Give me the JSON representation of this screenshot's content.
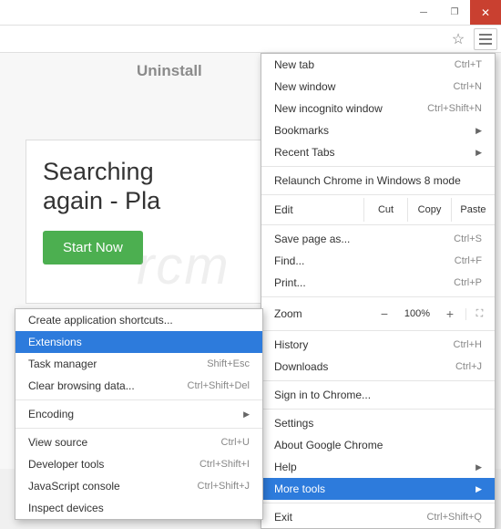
{
  "header": {
    "uninstall": "Uninstall"
  },
  "hero": {
    "title_line1": "Searching ",
    "title_line2": "again - Pla",
    "cta": "Start Now"
  },
  "watermark": "rcm",
  "menu": {
    "new_tab": "New tab",
    "new_tab_sc": "Ctrl+T",
    "new_window": "New window",
    "new_window_sc": "Ctrl+N",
    "new_incognito": "New incognito window",
    "new_incognito_sc": "Ctrl+Shift+N",
    "bookmarks": "Bookmarks",
    "recent_tabs": "Recent Tabs",
    "relaunch": "Relaunch Chrome in Windows 8 mode",
    "edit": "Edit",
    "cut": "Cut",
    "copy": "Copy",
    "paste": "Paste",
    "save_page": "Save page as...",
    "save_page_sc": "Ctrl+S",
    "find": "Find...",
    "find_sc": "Ctrl+F",
    "print": "Print...",
    "print_sc": "Ctrl+P",
    "zoom": "Zoom",
    "zoom_pct": "100%",
    "history": "History",
    "history_sc": "Ctrl+H",
    "downloads": "Downloads",
    "downloads_sc": "Ctrl+J",
    "signin": "Sign in to Chrome...",
    "settings": "Settings",
    "about": "About Google Chrome",
    "help": "Help",
    "more_tools": "More tools",
    "exit": "Exit",
    "exit_sc": "Ctrl+Shift+Q"
  },
  "submenu": {
    "create_shortcuts": "Create application shortcuts...",
    "extensions": "Extensions",
    "task_manager": "Task manager",
    "task_manager_sc": "Shift+Esc",
    "clear_browsing": "Clear browsing data...",
    "clear_browsing_sc": "Ctrl+Shift+Del",
    "encoding": "Encoding",
    "view_source": "View source",
    "view_source_sc": "Ctrl+U",
    "dev_tools": "Developer tools",
    "dev_tools_sc": "Ctrl+Shift+I",
    "js_console": "JavaScript console",
    "js_console_sc": "Ctrl+Shift+J",
    "inspect": "Inspect devices"
  }
}
